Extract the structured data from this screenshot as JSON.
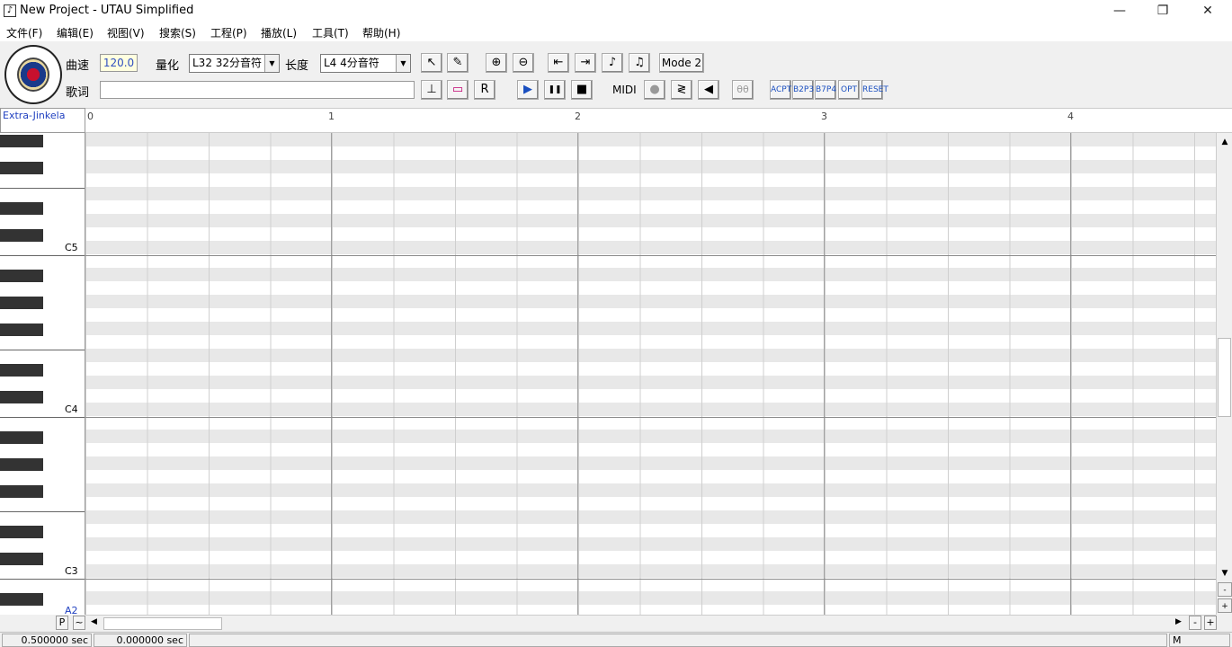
{
  "window": {
    "title": "New Project - UTAU Simplified",
    "app_icon": "music-note-icon",
    "controls": {
      "minimize": "—",
      "restore": "❐",
      "close": "✕"
    }
  },
  "menu": [
    {
      "label": "文件(F)"
    },
    {
      "label": "编辑(E)"
    },
    {
      "label": "视图(V)"
    },
    {
      "label": "搜索(S)"
    },
    {
      "label": "工程(P)"
    },
    {
      "label": "播放(L)"
    },
    {
      "label": "工具(T)"
    },
    {
      "label": "帮助(H)"
    }
  ],
  "toolbar": {
    "tempo_label": "曲速",
    "tempo_value": "120.0",
    "quantize_label": "量化",
    "quantize_value": "L32 32分音符",
    "length_label": "长度",
    "length_value": "L4 4分音符",
    "lyric_label": "歌词",
    "lyric_value": "",
    "mode_button": "Mode 2",
    "midi_label": "MIDI",
    "tool_icons": {
      "select": "↖",
      "pencil": "✎",
      "zoom_in": "⊕",
      "zoom_out": "⊖",
      "to_start": "⇤",
      "to_end": "⇥",
      "split_note": "♪",
      "join_note": "♫",
      "insert_rest": "⊥",
      "delete_rest": "▭",
      "replace": "R",
      "play": "▶",
      "pause": "❚❚",
      "stop": "■",
      "record": "●",
      "midi_link": "≷",
      "speaker": "◀",
      "phoneme": "θθ",
      "plug1": "ACPT",
      "plug2": "B2P3",
      "plug3": "B7P4",
      "plug4": "OPT",
      "plug5": "RESET"
    }
  },
  "track": {
    "singer": "Extra-Jinkela"
  },
  "ruler": {
    "measures": [
      "0",
      "1",
      "2",
      "3",
      "4"
    ]
  },
  "piano": {
    "octave_labels": [
      "C5",
      "C4",
      "C3",
      "A2"
    ]
  },
  "scroll": {
    "up": "▲",
    "down": "▼",
    "left": "◀",
    "right": "▶",
    "minus": "-",
    "plus": "+",
    "p_label": "P",
    "tilde": "~"
  },
  "status": {
    "time1": "0.500000 sec",
    "time2": "0.000000 sec",
    "mode": "M"
  }
}
